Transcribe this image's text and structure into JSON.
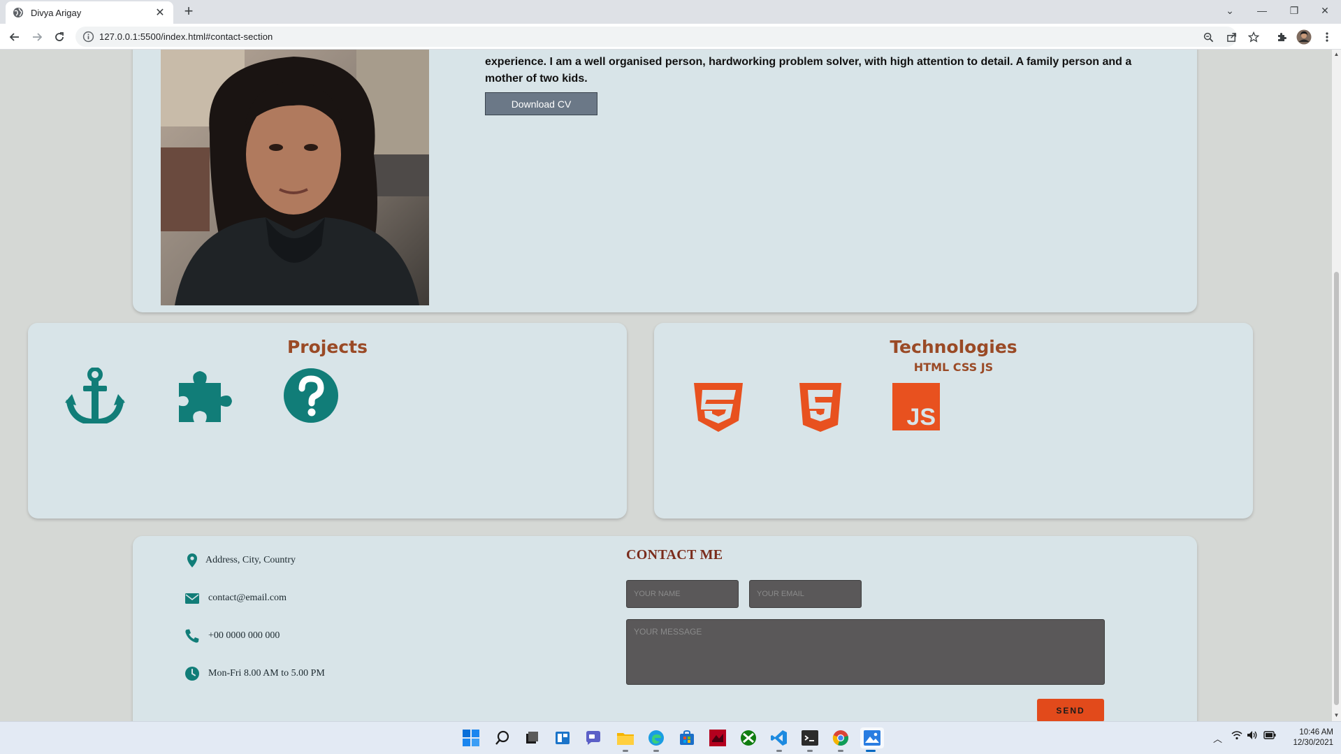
{
  "browser": {
    "tab_title": "Divya Arigay",
    "url": "127.0.0.1:5500/index.html#contact-section"
  },
  "about": {
    "bio": "experience. I am a well organised person, hardworking problem solver, with high attention to detail. A family person and a mother of two kids.",
    "download_cv_label": "Download CV"
  },
  "projects": {
    "title": "Projects",
    "icons": [
      "anchor-icon",
      "puzzle-icon",
      "question-circle-icon"
    ]
  },
  "technologies": {
    "title": "Technologies",
    "subtitle": "HTML CSS JS",
    "icons": [
      "css3-icon",
      "html5-icon",
      "js-icon"
    ]
  },
  "contact": {
    "title": "CONTACT ME",
    "address": "Address, City, Country",
    "email": "contact@email.com",
    "phone": "+00 0000 000 000",
    "hours": "Mon-Fri 8.00 AM to 5.00 PM",
    "name_placeholder": "YOUR NAME",
    "email_placeholder": "YOUR EMAIL",
    "message_placeholder": "YOUR MESSAGE",
    "send_label": "SEND"
  },
  "taskbar": {
    "time": "10:46 AM",
    "date": "12/30/2021"
  },
  "colors": {
    "accent_teal": "#117d78",
    "heading_brown": "#9a4a26",
    "card_bg": "#d8e4e8",
    "send_orange": "#e24a1b",
    "tech_orange": "#e8511f"
  }
}
